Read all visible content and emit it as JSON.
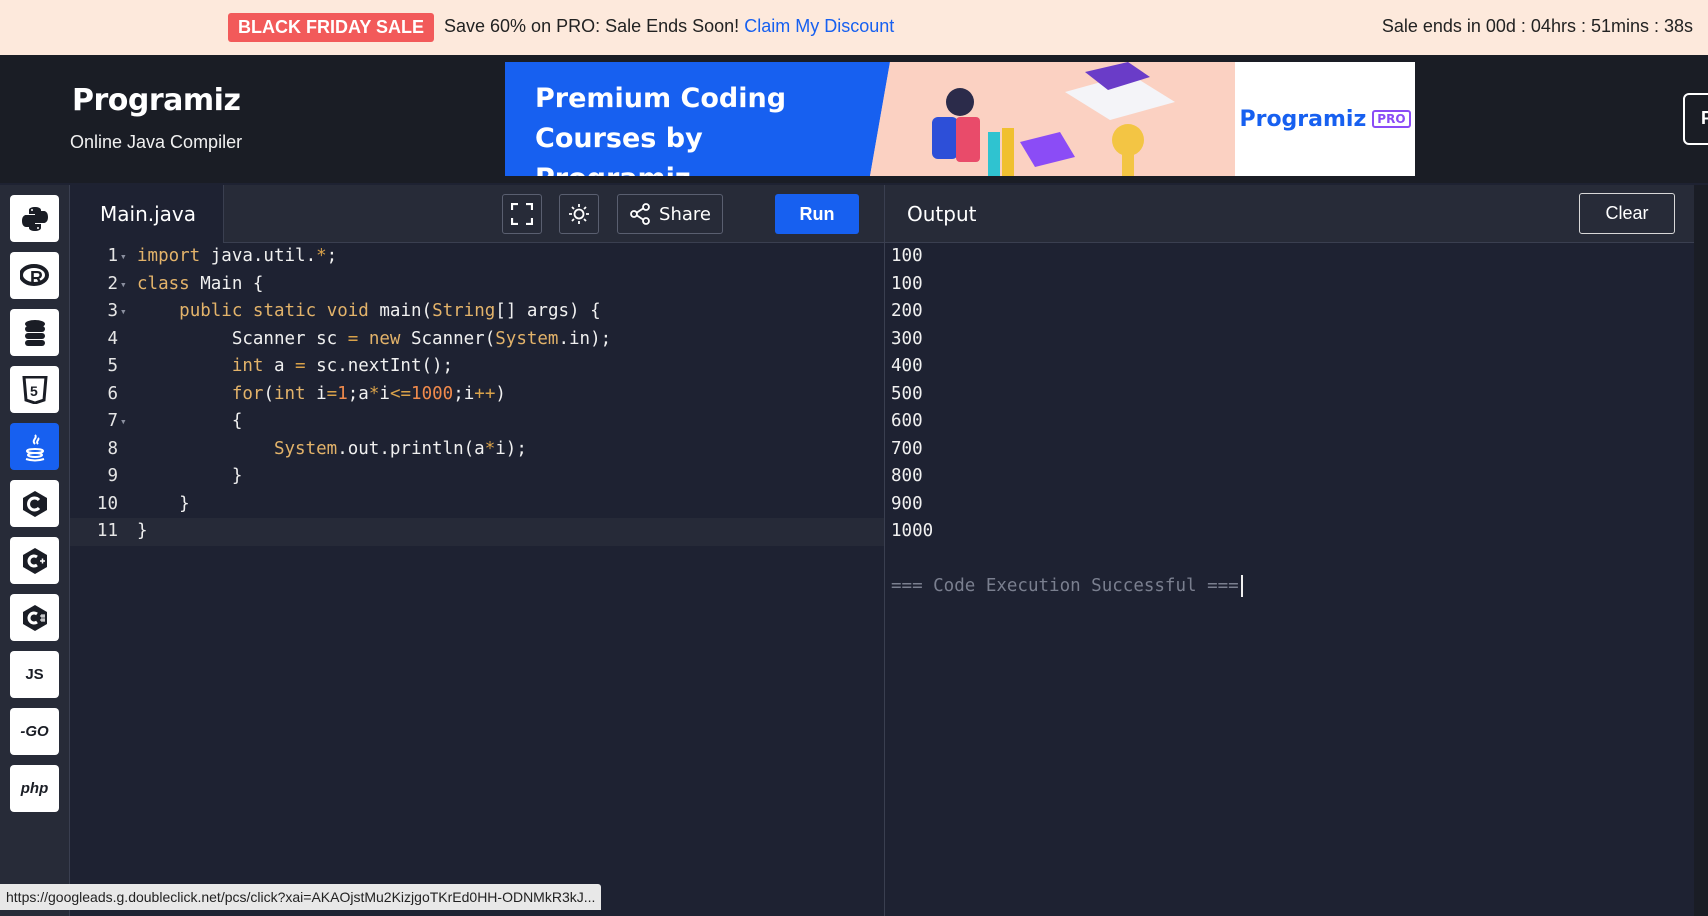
{
  "promo": {
    "badge": "BLACK FRIDAY SALE",
    "message": "Save 60% on PRO: Sale Ends Soon!",
    "link": "Claim My Discount",
    "timer": "Sale ends in 00d : 04hrs : 51mins : 38s"
  },
  "header": {
    "logo": "Programiz",
    "subtitle": "Online Java Compiler",
    "ad_heading_1": "Premium Coding",
    "ad_heading_2": "Courses by Programiz",
    "ad_brand": "Programiz",
    "ad_pro": "PRO",
    "edge_button": "P"
  },
  "sidebar": {
    "languages": [
      {
        "name": "python",
        "label": ""
      },
      {
        "name": "r",
        "label": ""
      },
      {
        "name": "sql",
        "label": ""
      },
      {
        "name": "html",
        "label": ""
      },
      {
        "name": "java",
        "label": ""
      },
      {
        "name": "c",
        "label": ""
      },
      {
        "name": "cpp",
        "label": ""
      },
      {
        "name": "csharp",
        "label": ""
      },
      {
        "name": "javascript",
        "label": "JS"
      },
      {
        "name": "go",
        "label": "-GO"
      },
      {
        "name": "php",
        "label": "php"
      }
    ]
  },
  "editor": {
    "filename": "Main.java",
    "share_label": "Share",
    "run_label": "Run",
    "lines": [
      "import java.util.*;",
      "class Main {",
      "    public static void main(String[] args) {",
      "         Scanner sc = new Scanner(System.in);",
      "         int a = sc.nextInt();",
      "         for(int i=1;a*i<=1000;i++)",
      "         {",
      "             System.out.println(a*i);",
      "         }",
      "    }",
      "}"
    ]
  },
  "output": {
    "title": "Output",
    "clear_label": "Clear",
    "lines": [
      "100",
      "100",
      "200",
      "300",
      "400",
      "500",
      "600",
      "700",
      "800",
      "900",
      "1000"
    ],
    "success": "=== Code Execution Successful ==="
  },
  "status_url": "https://googleads.g.doubleclick.net/pcs/click?xai=AKAOjstMu2KizjgoTKrEd0HH-ODNMkR3kJ..."
}
